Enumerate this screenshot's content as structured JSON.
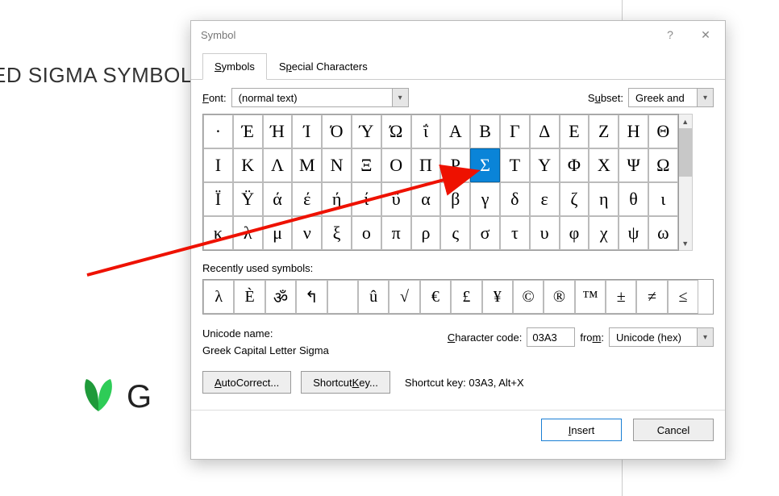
{
  "background": {
    "text": "ED SIGMA SYMBOL",
    "logo_text": "G"
  },
  "dialog": {
    "title": "Symbol",
    "tabs": {
      "symbols": "Symbols",
      "special": "Special Characters"
    },
    "font_label": "Font:",
    "font_value": "(normal text)",
    "subset_label": "Subset:",
    "subset_value": "Greek and",
    "grid_rows": [
      [
        "·",
        "Έ",
        "Ή",
        "Ί",
        "Ό",
        "Ύ",
        "Ώ",
        "ΐ",
        "Α",
        "Β",
        "Γ",
        "Δ",
        "Ε",
        "Ζ",
        "Η",
        "Θ"
      ],
      [
        "Ι",
        "Κ",
        "Λ",
        "Μ",
        "Ν",
        "Ξ",
        "Ο",
        "Π",
        "Ρ",
        "Σ",
        "Τ",
        "Υ",
        "Φ",
        "Χ",
        "Ψ",
        "Ω"
      ],
      [
        "Ϊ",
        "Ϋ",
        "ά",
        "έ",
        "ή",
        "ί",
        "ΰ",
        "α",
        "β",
        "γ",
        "δ",
        "ε",
        "ζ",
        "η",
        "θ",
        "ι"
      ],
      [
        "κ",
        "λ",
        "μ",
        "ν",
        "ξ",
        "ο",
        "π",
        "ρ",
        "ς",
        "σ",
        "τ",
        "υ",
        "φ",
        "χ",
        "ψ",
        "ω"
      ]
    ],
    "selected": {
      "row": 1,
      "col": 9
    },
    "recent_label": "Recently used symbols:",
    "recent": [
      "λ",
      "È",
      "ॐ",
      "↰",
      "",
      "û",
      "√",
      "€",
      "£",
      "¥",
      "©",
      "®",
      "™",
      "±",
      "≠",
      "≤"
    ],
    "unicode_name_label": "Unicode name:",
    "unicode_name": "Greek Capital Letter Sigma",
    "char_code_label": "Character code:",
    "char_code_value": "03A3",
    "from_label": "from:",
    "from_value": "Unicode (hex)",
    "btn_autocorrect": "AutoCorrect...",
    "btn_shortcut": "Shortcut Key...",
    "shortcut_info": "Shortcut key: 03A3, Alt+X",
    "btn_insert": "Insert",
    "btn_cancel": "Cancel"
  }
}
